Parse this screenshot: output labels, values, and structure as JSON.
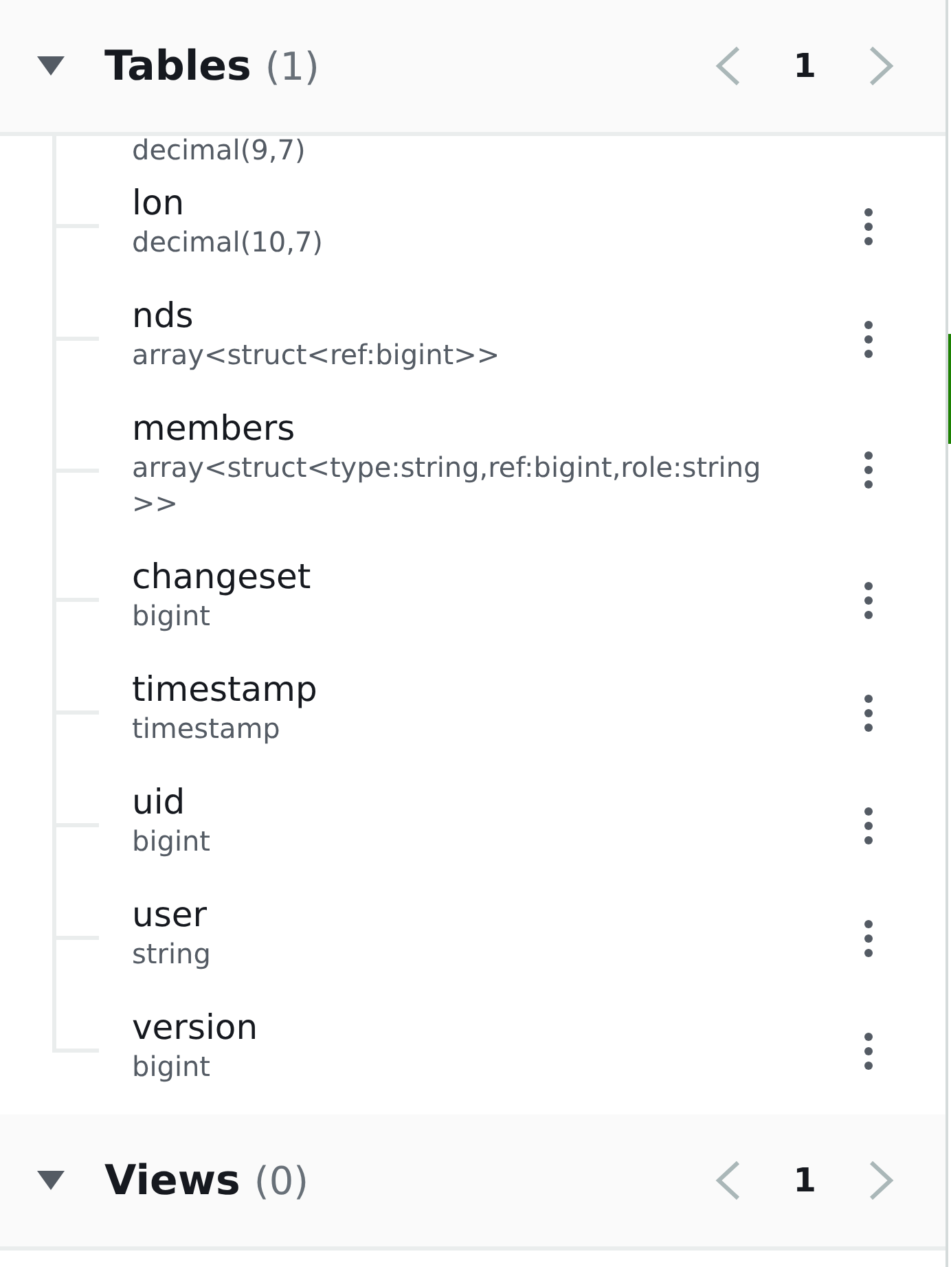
{
  "sections": [
    {
      "title": "Tables",
      "count": "(1)",
      "expanded": true,
      "page": "1",
      "prev_disabled": true,
      "next_disabled": true,
      "columns": [
        {
          "type": "decimal(9,7)"
        },
        {
          "name": "lon",
          "type": "decimal(10,7)"
        },
        {
          "name": "nds",
          "type": "array<struct<ref:bigint>>"
        },
        {
          "name": "members",
          "type": "array<struct<type:string,ref:bigint,role:string>>"
        },
        {
          "name": "changeset",
          "type": "bigint"
        },
        {
          "name": "timestamp",
          "type": "timestamp"
        },
        {
          "name": "uid",
          "type": "bigint"
        },
        {
          "name": "user",
          "type": "string"
        },
        {
          "name": "version",
          "type": "bigint"
        }
      ]
    },
    {
      "title": "Views",
      "count": "(0)",
      "expanded": true,
      "page": "1",
      "prev_disabled": true,
      "next_disabled": true
    }
  ]
}
